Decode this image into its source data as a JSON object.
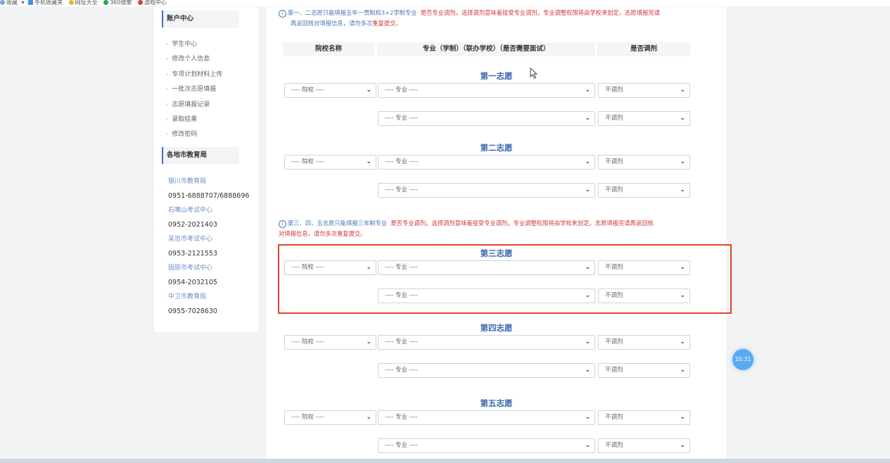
{
  "bookmarks": [
    {
      "label": "收藏",
      "color": "#7aa7dd"
    },
    {
      "label": "手机收藏夹",
      "color": "#4a8ee0"
    },
    {
      "label": "网址大全",
      "color": "#e8b82a"
    },
    {
      "label": "360搜索",
      "color": "#2aa54a"
    },
    {
      "label": "游戏中心",
      "color": "#d94040"
    }
  ],
  "sidebar": {
    "account_title": "账户中心",
    "menu": [
      "学生中心",
      "修改个人信息",
      "专项计划材料上传",
      "一批次志愿填报",
      "志愿填报记录",
      "录取结果",
      "修改密码"
    ],
    "edu_title": "各地市教育局",
    "contacts": [
      {
        "name": "银川市教育局",
        "phone": "0951-6888707/6888696"
      },
      {
        "name": "石嘴山考试中心",
        "phone": "0952-2021403"
      },
      {
        "name": "吴忠市考试中心",
        "phone": "0953-2121553"
      },
      {
        "name": "固原市考试中心",
        "phone": "0954-2032105"
      },
      {
        "name": "中卫市教育局",
        "phone": "0955-7028630"
      }
    ]
  },
  "notice1": {
    "blue": "第一、二志愿只能填报五年一贯制和3+2学制专业",
    "red": "是否专业调剂，选择调剂意味着接受专业调剂，专业调整权限将由学校来划定。志愿填报完请",
    "line2_blue": "再返回核对填报信息，请勿多次",
    "line2_red": "重复提交。"
  },
  "notice2": {
    "blue": "第三、四、五志愿只能填报三年制专业",
    "red": "是否专业调剂，选择调剂意味着接受专业调剂，专业调整权限将由学校来划定。志愿填报完请再返回核",
    "line2_red": "对填报信息，请勿多次重复提交。"
  },
  "table_headers": [
    "院校名称",
    "专业（学制）（联办学校）（是否需要面试）",
    "是否调剂"
  ],
  "placeholders": {
    "school": "---- 院校 ----",
    "major": "---- 专业 ----",
    "adjust": "不调剂"
  },
  "groups": [
    {
      "title": "第一志愿"
    },
    {
      "title": "第二志愿"
    },
    {
      "title": "第三志愿"
    },
    {
      "title": "第四志愿"
    },
    {
      "title": "第五志愿"
    }
  ],
  "timer": "10:31",
  "colors": {
    "accent": "#3d68ad",
    "warning": "#d23a3a",
    "highlight": "#e0432b",
    "timer": "#5aaaf0"
  }
}
